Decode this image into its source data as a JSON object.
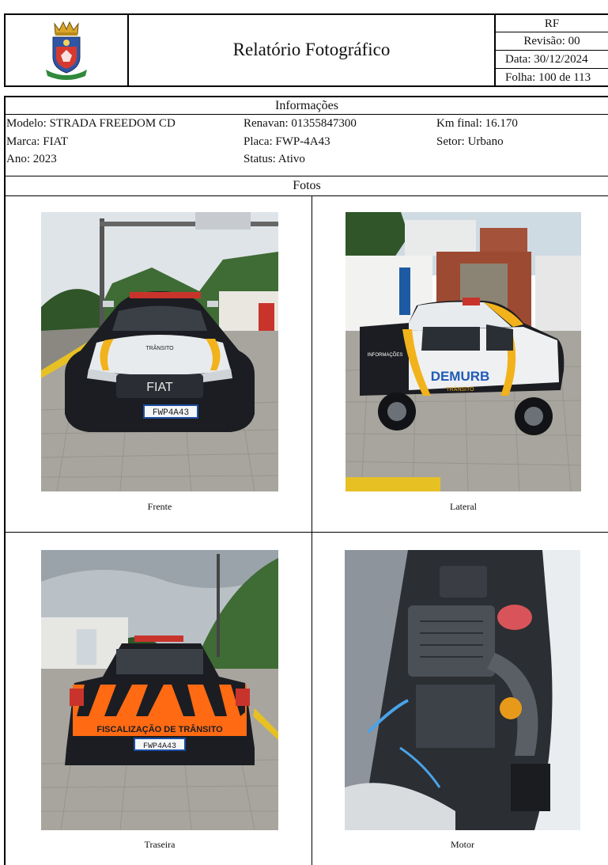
{
  "header": {
    "title": "Relatório Fotográfico",
    "doc_code": "RF",
    "revision": "Revisão: 00",
    "date": "Data: 30/12/2024",
    "sheet": "Folha: 100 de 113"
  },
  "info": {
    "section_title": "Informações",
    "modelo": "Modelo: STRADA FREEDOM CD",
    "marca": "Marca: FIAT",
    "ano": "Ano: 2023",
    "renavan": "Renavan: 01355847300",
    "placa": "Placa: FWP-4A43",
    "status": "Status: Ativo",
    "km_final": "Km final: 16.170",
    "setor": "Setor: Urbano"
  },
  "photos": {
    "section_title": "Fotos",
    "items": [
      {
        "caption": "Frente",
        "plate_text": "FWP4A43",
        "brand_text": "FIAT"
      },
      {
        "caption": "Lateral",
        "door_text": "DEMURB",
        "door_sub": "TRÂNSITO",
        "info_text": "INFORMAÇÕES"
      },
      {
        "caption": "Traseira",
        "plate_text": "FWP4A43",
        "tailgate_text": "FISCALIZAÇÃO DE TRÂNSITO"
      },
      {
        "caption": "Motor"
      }
    ]
  },
  "colors": {
    "border": "#000000",
    "car_body": "#1b1d22",
    "hood_white": "#e8ebee",
    "stripe_yellow": "#f2b21b",
    "stripe_orange": "#ff6a13",
    "pavement": "#a8a59e",
    "sky": "#dfe5ea",
    "foliage": "#3f6b34"
  }
}
